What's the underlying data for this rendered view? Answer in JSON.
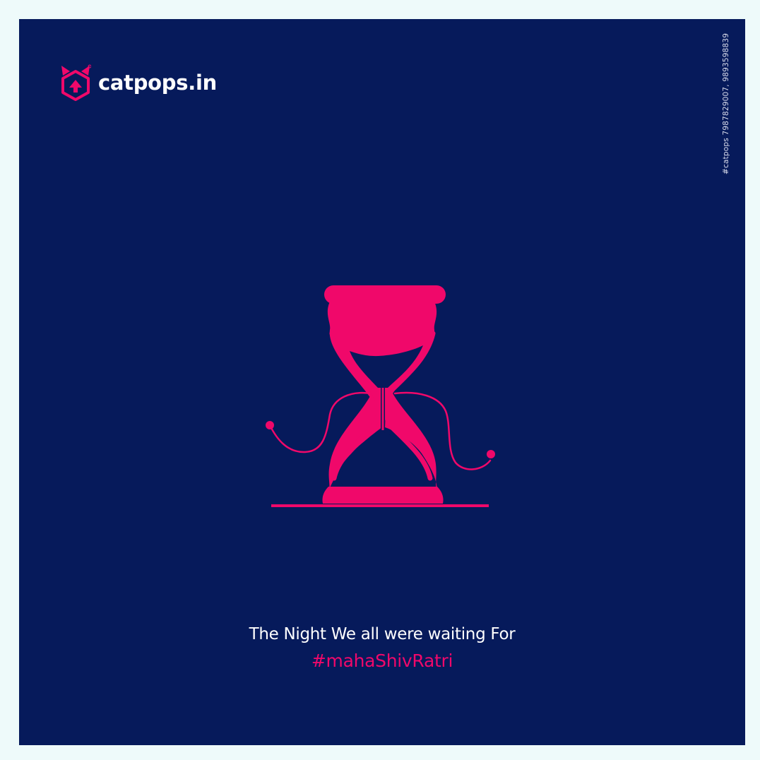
{
  "brand": {
    "name": "catpops.in",
    "icon": "cat-hexagon-logo-icon"
  },
  "side_contact": "#catpops 7987829007, 9893598839",
  "illustration": {
    "icon": "hourglass-character-icon"
  },
  "caption": "The Night We all were waiting For",
  "hashtag": "#mahaShivRatri",
  "colors": {
    "background": "#061a5b",
    "accent": "#f0086a",
    "text": "#ffffff",
    "outer": "#eefafa"
  }
}
